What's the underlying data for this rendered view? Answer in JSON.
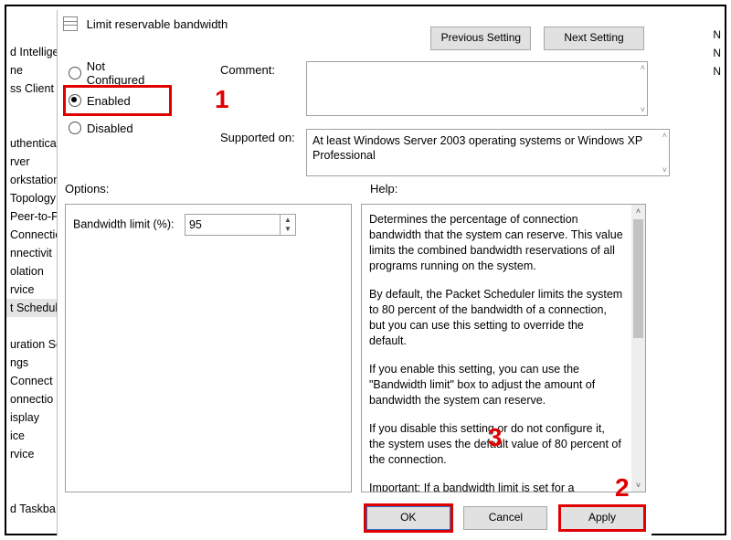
{
  "bg_list": {
    "top": [
      "d Intellige",
      "ne",
      "ss Client E"
    ],
    "mid": [
      "uthenticat",
      "rver",
      "orkstation",
      "Topology",
      "Peer-to-P",
      "Connection",
      "nnectivit",
      "olation",
      "rvice"
    ],
    "selected": "t Schedul",
    "low": [
      "uration Se",
      "ngs",
      "Connect N",
      "onnectio",
      "isplay",
      "ice",
      "rvice"
    ],
    "bottom": [
      "d Taskba"
    ]
  },
  "right_col": [
    "N",
    "N",
    "N"
  ],
  "dialog": {
    "title": "Limit reservable bandwidth",
    "nav": {
      "prev": "Previous Setting",
      "next": "Next Setting"
    },
    "radios": {
      "not_configured": "Not Configured",
      "enabled": "Enabled",
      "disabled": "Disabled"
    },
    "comment_label": "Comment:",
    "comment_value": "",
    "supported_label": "Supported on:",
    "supported_value": "At least Windows Server 2003 operating systems or Windows XP Professional",
    "options_label": "Options:",
    "help_label": "Help:",
    "bandwidth_label": "Bandwidth limit (%):",
    "bandwidth_value": "95",
    "help_paragraphs": [
      "Determines the percentage of connection bandwidth that the system can reserve. This value limits the combined bandwidth reservations of all programs running on the system.",
      "By default, the Packet Scheduler limits the system to 80 percent of the bandwidth of a connection, but you can use this setting to override the default.",
      "If you enable this setting, you can use the \"Bandwidth limit\" box to adjust the amount of bandwidth the system can reserve.",
      "If you disable this setting or do not configure it, the system uses the default value of 80 percent of the connection.",
      "Important: If a bandwidth limit is set for a particular network adapter in the registry, this setting is ignor"
    ],
    "buttons": {
      "ok": "OK",
      "cancel": "Cancel",
      "apply": "Apply"
    }
  },
  "annotations": {
    "one": "1",
    "two": "2",
    "three": "3"
  }
}
